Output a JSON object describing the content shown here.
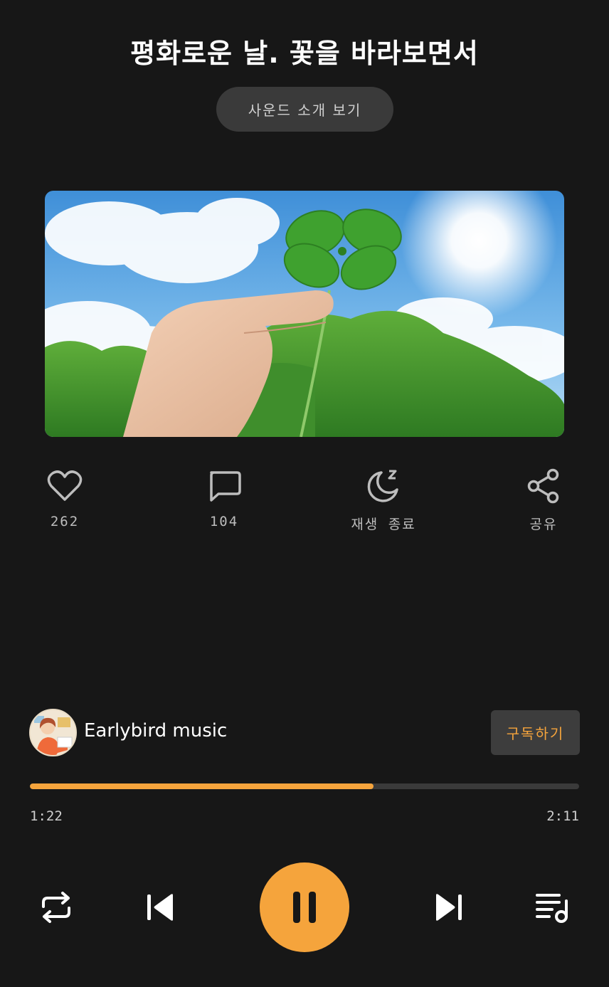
{
  "header": {
    "title": "평화로운 날. 꽃을 바라보면서",
    "intro_button": "사운드 소개 보기"
  },
  "artwork": {
    "description_icon": "four-leaf-clover-image"
  },
  "actions": [
    {
      "icon": "heart-icon",
      "label": "262"
    },
    {
      "icon": "comment-icon",
      "label": "104"
    },
    {
      "icon": "sleep-timer-icon",
      "label": "재생 종료"
    },
    {
      "icon": "share-icon",
      "label": "공유"
    }
  ],
  "channel": {
    "name": "Earlybird music",
    "subscribe_label": "구독하기"
  },
  "player": {
    "current_time": "1:22",
    "total_time": "2:11",
    "progress_fraction": 0.626,
    "accent_color": "#f5a43c"
  },
  "controls": {
    "repeat_icon": "repeat-icon",
    "prev_icon": "skip-previous-icon",
    "play_pause_icon": "pause-icon",
    "next_icon": "skip-next-icon",
    "queue_icon": "playlist-icon"
  }
}
